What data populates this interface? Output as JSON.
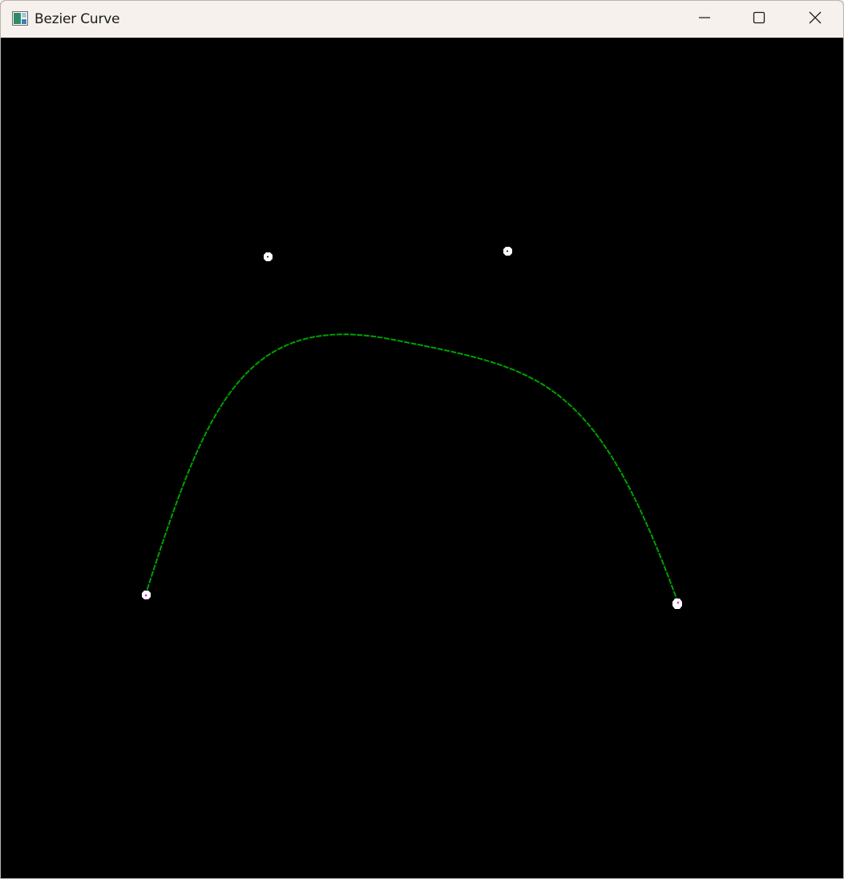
{
  "window": {
    "title": "Bezier Curve",
    "icon": "app-window-icon"
  },
  "controls": {
    "minimize_icon": "minimize-icon",
    "maximize_icon": "maximize-icon",
    "close_icon": "close-icon"
  },
  "canvas": {
    "background": "#000000",
    "curve_color": "#00a000",
    "control_point_color": "#ffffff",
    "endpoint_marker_color": "#ff00ff"
  }
}
